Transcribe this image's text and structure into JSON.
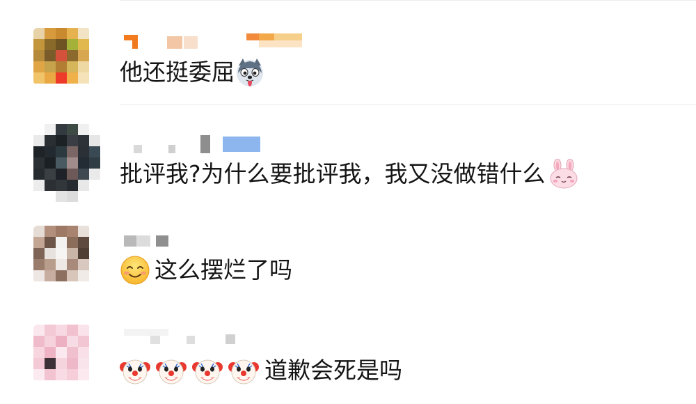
{
  "comments": [
    {
      "text": "他还挺委屈",
      "emoji": "husky-dog-emoji"
    },
    {
      "text": "批评我?为什么要批评我，我又没做错什么",
      "emoji": "bunny-face-emoji"
    },
    {
      "text": "这么摆烂了吗",
      "emoji": "smiling-face-emoji"
    },
    {
      "text": "道歉会死是吗",
      "emoji": "clown-face-emoji"
    }
  ],
  "colors": {
    "text": "#151515",
    "divider": "#ececec",
    "background": "#ffffff"
  }
}
